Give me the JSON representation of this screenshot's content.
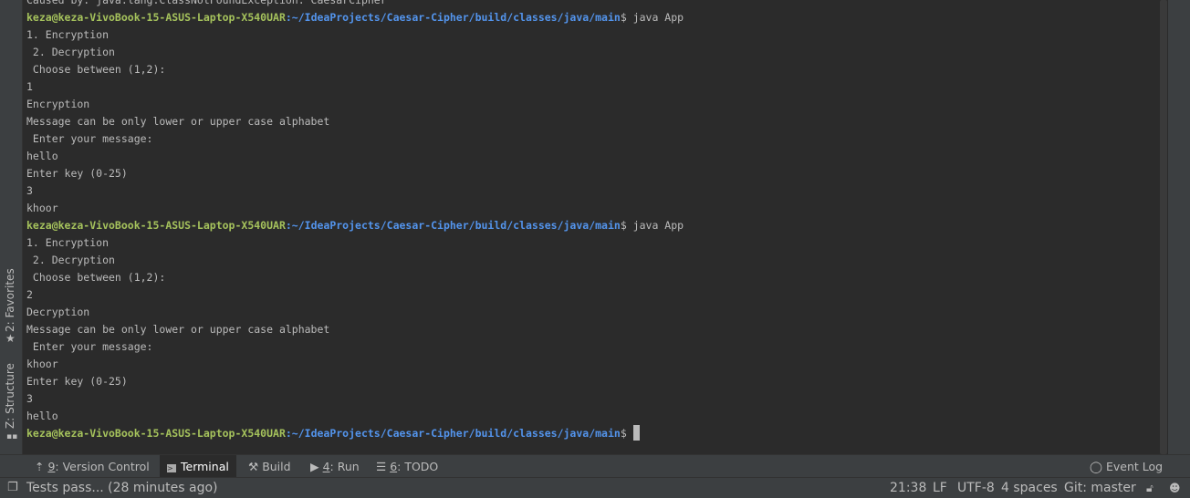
{
  "left_sidebar": {
    "tabs": [
      {
        "label": "2: Favorites",
        "icon": "star-icon"
      },
      {
        "label": "Z: Structure",
        "icon": "structure-icon"
      }
    ]
  },
  "terminal": {
    "prompt_user": "keza@keza-VivoBook-15-ASUS-Laptop-X540UAR",
    "prompt_path": ":~/IdeaProjects/Caesar-Cipher/build/classes/java/main",
    "lines": [
      {
        "text": "Caused by: java.lang.ClassNotFoundException: CaesarCipher"
      },
      {
        "prompt": true,
        "cmd": "$ java App"
      },
      {
        "text": "1. Encryption"
      },
      {
        "text": " 2. Decryption"
      },
      {
        "text": " Choose between (1,2):"
      },
      {
        "text": "1"
      },
      {
        "text": "Encryption"
      },
      {
        "text": "Message can be only lower or upper case alphabet"
      },
      {
        "text": " Enter your message:"
      },
      {
        "text": "hello"
      },
      {
        "text": "Enter key (0-25)"
      },
      {
        "text": "3"
      },
      {
        "text": "khoor"
      },
      {
        "prompt": true,
        "cmd": "$ java App"
      },
      {
        "text": "1. Encryption"
      },
      {
        "text": " 2. Decryption"
      },
      {
        "text": " Choose between (1,2):"
      },
      {
        "text": "2"
      },
      {
        "text": "Decryption"
      },
      {
        "text": "Message can be only lower or upper case alphabet"
      },
      {
        "text": " Enter your message:"
      },
      {
        "text": "khoor"
      },
      {
        "text": "Enter key (0-25)"
      },
      {
        "text": "3"
      },
      {
        "text": "hello"
      },
      {
        "prompt": true,
        "cmd": "$ ",
        "cursor": true
      }
    ]
  },
  "toolwindows": [
    {
      "key": "9",
      "label": ": Version Control",
      "icon": "version-control-icon"
    },
    {
      "key": "",
      "label": "Terminal",
      "icon": "terminal-icon",
      "active": true
    },
    {
      "key": "",
      "label": "Build",
      "icon": "hammer-icon"
    },
    {
      "key": "4",
      "label": ": Run",
      "icon": "play-icon"
    },
    {
      "key": "6",
      "label": ": TODO",
      "icon": "list-icon"
    }
  ],
  "event_log": "Event Log",
  "status": {
    "message": "Tests pass... (28 minutes ago)",
    "position": "21:38",
    "line_sep": "LF",
    "encoding": "UTF-8",
    "indent": "4 spaces",
    "vcs": "Git: master"
  },
  "colors": {
    "background": "#2b2b2b",
    "prompt_user": "#a5c25c",
    "prompt_path": "#5394ec",
    "text": "#bbbbbb",
    "chrome": "#3c3f41"
  }
}
